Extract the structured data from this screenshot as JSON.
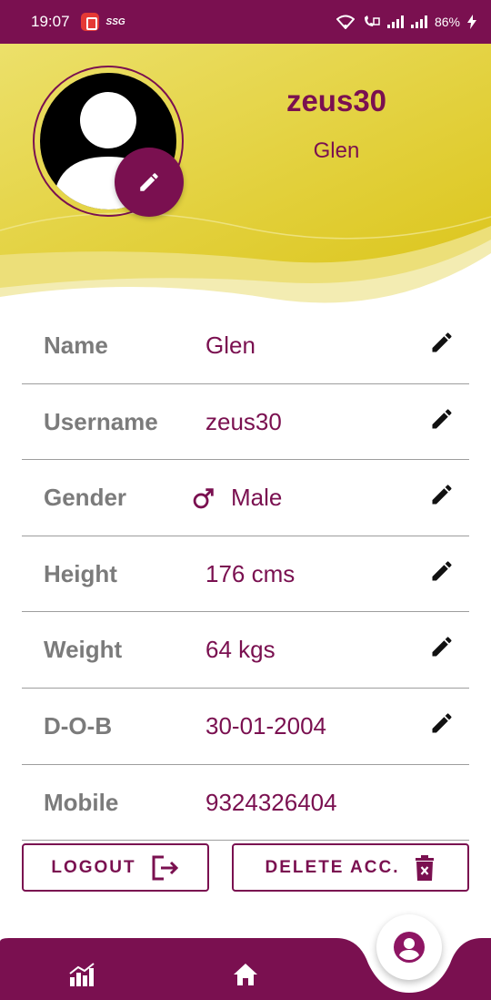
{
  "status_bar": {
    "time": "19:07",
    "carrier_badge": "SSG",
    "battery": "86%"
  },
  "profile": {
    "username": "zeus30",
    "display_name": "Glen"
  },
  "fields": [
    {
      "label": "Name",
      "value": "Glen",
      "editable": true
    },
    {
      "label": "Username",
      "value": "zeus30",
      "editable": true
    },
    {
      "label": "Gender",
      "value": "Male",
      "icon": "male-gender-icon",
      "editable": true
    },
    {
      "label": "Height",
      "value": "176 cms",
      "editable": true
    },
    {
      "label": "Weight",
      "value": "64 kgs",
      "editable": true
    },
    {
      "label": "D-O-B",
      "value": "30-01-2004",
      "editable": true
    },
    {
      "label": "Mobile",
      "value": "9324326404",
      "editable": false
    }
  ],
  "actions": {
    "logout_label": "LOGOUT",
    "delete_label": "DELETE ACC."
  },
  "nav": {
    "items": [
      "stats-icon",
      "home-icon",
      "profile-icon"
    ],
    "active": "profile-icon"
  },
  "colors": {
    "primary": "#7a1050",
    "header_yellow": "#e3d13a",
    "label_gray": "#7b7b7b"
  }
}
